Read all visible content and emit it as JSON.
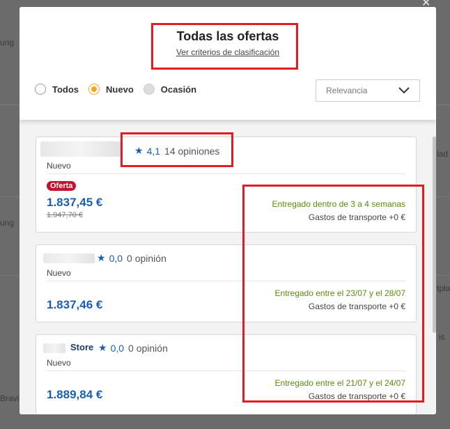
{
  "background": {
    "snippets": [
      "ung",
      "ung",
      "lad",
      "tpla",
      "is",
      "Bravi"
    ]
  },
  "modal": {
    "title": "Todas las ofertas",
    "criteria_link": "Ver criterios de clasificación",
    "filters": [
      {
        "label": "Todos",
        "state": "unselected"
      },
      {
        "label": "Nuevo",
        "state": "selected"
      },
      {
        "label": "Ocasión",
        "state": "disabled"
      }
    ],
    "sort": {
      "selected": "Relevancia"
    }
  },
  "offers": [
    {
      "store": "",
      "rating": "4,1",
      "reviews": "14 opiniones",
      "condition": "Nuevo",
      "badge": "Oferta",
      "price": "1.837,45 €",
      "old_price": "1.947,70 €",
      "delivery": "Entregado dentro de 3 a 4 semanas",
      "shipping": "Gastos de transporte +0 €"
    },
    {
      "store": "",
      "rating": "0,0",
      "reviews": "0 opinión",
      "condition": "Nuevo",
      "price": "1.837,46 €",
      "delivery": "Entregado entre el 23/07 y el 28/07",
      "shipping": "Gastos de transporte +0 €"
    },
    {
      "store": "Store",
      "rating": "0,0",
      "reviews": "0 opinión",
      "condition": "Nuevo",
      "price": "1.889,84 €",
      "delivery": "Entregado entre el 21/07 y el 24/07",
      "shipping": "Gastos de transporte +0 €"
    }
  ],
  "colors": {
    "accent_blue": "#1a5fb4",
    "delivery_green": "#5a8a0a",
    "highlight_red": "#e31b23",
    "badge_red": "#c8102e",
    "radio_orange": "#f5a623"
  }
}
